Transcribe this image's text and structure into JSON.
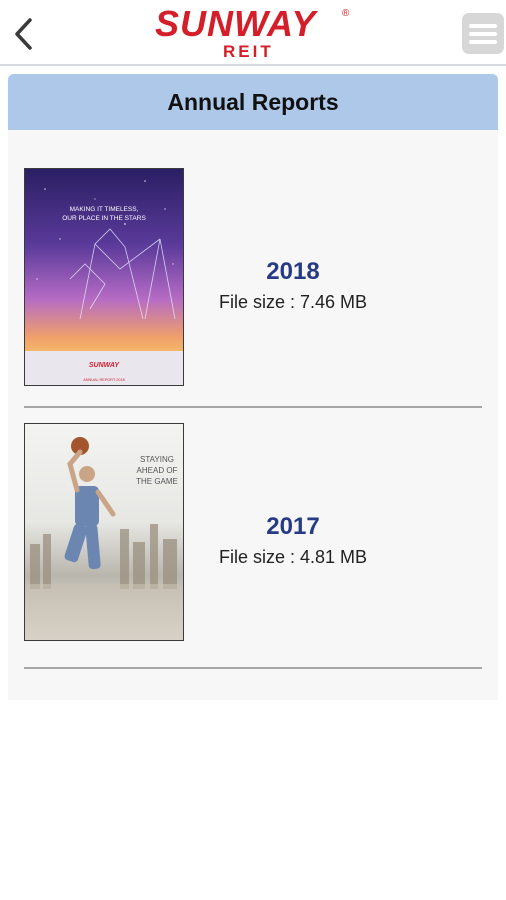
{
  "header": {
    "back_icon": "chevron-left-icon",
    "logo_main": "SUNWAY",
    "logo_registered": "®",
    "logo_sub": "REIT",
    "menu_icon": "hamburger-menu-icon",
    "brand_color": "#d41f2a"
  },
  "page": {
    "title": "Annual Reports",
    "header_color": "#aec8ea"
  },
  "reports": [
    {
      "year": "2018",
      "file_size": "File size : 7.46 MB",
      "cover_text_1": "MAKING IT TIMELESS,",
      "cover_text_2": "OUR PLACE IN THE STARS",
      "cover_brand": "SUNWAY",
      "cover_foot": "ANNUAL REPORT 2018"
    },
    {
      "year": "2017",
      "file_size": "File size : 4.81 MB",
      "cover_text_1": "STAYING",
      "cover_text_2": "AHEAD OF",
      "cover_text_3": "THE GAME"
    }
  ]
}
